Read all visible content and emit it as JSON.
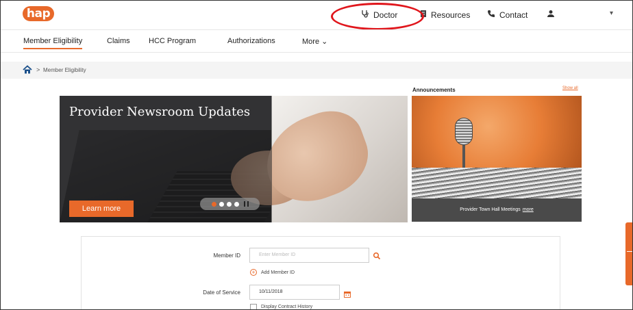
{
  "header": {
    "logo_text": "hap",
    "nav": [
      {
        "label": "Doctor",
        "icon": "stethoscope-icon"
      },
      {
        "label": "Resources",
        "icon": "document-icon"
      },
      {
        "label": "Contact",
        "icon": "phone-icon"
      },
      {
        "label": "",
        "icon": "user-icon"
      }
    ]
  },
  "subnav": {
    "items": [
      {
        "label": "Member Eligibility",
        "active": true
      },
      {
        "label": "Claims"
      },
      {
        "label": "HCC Program"
      },
      {
        "label": "Authorizations"
      },
      {
        "label": "More ⌄"
      }
    ]
  },
  "breadcrumb": {
    "separator": ">",
    "current": "Member Eligibility"
  },
  "hero": {
    "title": "Provider Newsroom Updates",
    "button_label": "Learn more",
    "carousel_slides": 4,
    "active_slide": 1
  },
  "announcements": {
    "title": "Announcements",
    "show_all": "Show all",
    "caption": "Provider Town Hall Meetings",
    "more": "more"
  },
  "form": {
    "member_id_label": "Member ID",
    "member_id_placeholder": "Enter Member ID",
    "add_member_label": "Add Member ID",
    "date_label": "Date of Service",
    "date_value": "10/11/2018",
    "contract_history_label": "Display Contract History"
  },
  "colors": {
    "accent": "#e8692a",
    "annotation": "#e0161c"
  }
}
